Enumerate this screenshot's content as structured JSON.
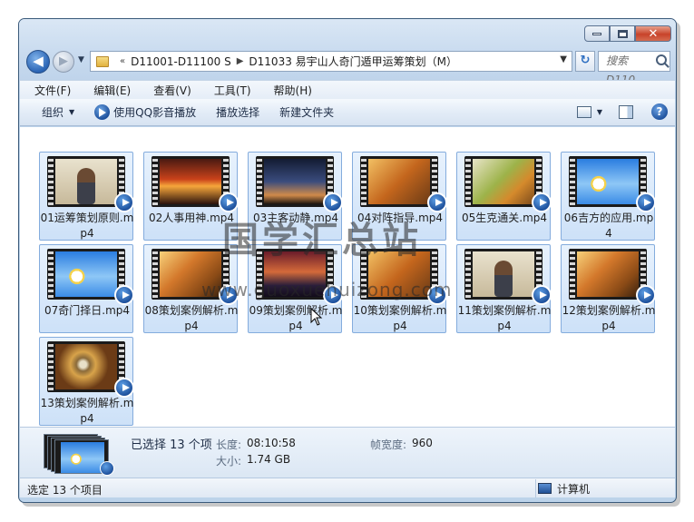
{
  "window": {
    "caption_buttons": [
      "minimize",
      "maximize",
      "close"
    ],
    "close_glyph": "✕"
  },
  "nav": {
    "back_glyph": "◀",
    "forward_glyph": "▶",
    "history_glyph": "▼",
    "address": {
      "prefix": "«",
      "segments": [
        "D11001-D11100 S",
        "D11033 易宇山人奇门遁甲运筹策划（M）"
      ],
      "separator": "▶",
      "dropdown_glyph": "▼"
    },
    "refresh_glyph": "↻",
    "search": {
      "placeholder": "搜索 D110..."
    }
  },
  "menu": {
    "items": [
      "文件(F)",
      "编辑(E)",
      "查看(V)",
      "工具(T)",
      "帮助(H)"
    ]
  },
  "toolbar": {
    "organize_label": "组织",
    "play_qq_label": "使用QQ影音播放",
    "play_selection_label": "播放选择",
    "new_folder_label": "新建文件夹",
    "help_glyph": "?",
    "dropdown_glyph": "▼"
  },
  "files": [
    {
      "name": "01运筹策划原则.mp4",
      "thumb": "person"
    },
    {
      "name": "02人事用神.mp4",
      "thumb": "sunset"
    },
    {
      "name": "03主客动静.mp4",
      "thumb": "tree"
    },
    {
      "name": "04对阵指导.mp4",
      "thumb": "autumn"
    },
    {
      "name": "05生克通关.mp4",
      "thumb": "leaf"
    },
    {
      "name": "06吉方的应用.mp4",
      "thumb": "daisy"
    },
    {
      "name": "07奇门择日.mp4",
      "thumb": "daisy"
    },
    {
      "name": "08策划案例解析.mp4",
      "thumb": "fall"
    },
    {
      "name": "09策划案例解析.mp4",
      "thumb": "dusk"
    },
    {
      "name": "10策划案例解析.mp4",
      "thumb": "autumn"
    },
    {
      "name": "11策划案例解析.mp4",
      "thumb": "person"
    },
    {
      "name": "12策划案例解析.mp4",
      "thumb": "fall"
    },
    {
      "name": "13策划案例解析.mp4",
      "thumb": "vortex"
    }
  ],
  "details": {
    "selected_text": "已选择 13 个项",
    "length_label": "长度:",
    "length_value": "08:10:58",
    "size_label": "大小:",
    "size_value": "1.74 GB",
    "frame_width_label": "帧宽度:",
    "frame_width_value": "960"
  },
  "status": {
    "left_text": "选定 13 个项目",
    "location_text": "计算机"
  },
  "watermark": {
    "text": "国学汇总站",
    "url": "www.guoxuehuizong.com"
  },
  "colors": {
    "selection_fill": "#cde1f8",
    "selection_border": "#84acdd",
    "chrome": "#bcd3ea",
    "close_button": "#c8432a"
  }
}
